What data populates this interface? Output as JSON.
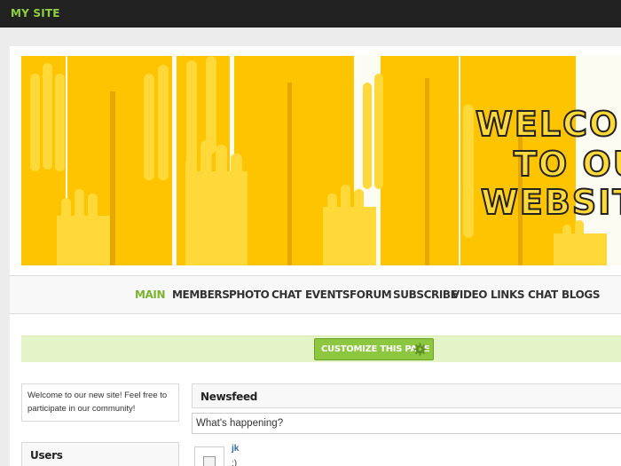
{
  "header": {
    "site_title": "MY SITE"
  },
  "banner": {
    "welcome_lines": [
      "WELCO",
      "TO OU",
      "WEBSIT"
    ],
    "colors": {
      "hand_main": "#ffc400",
      "hand_light": "#ffd93a",
      "hand_dark": "#e6a800",
      "background": "#fdfcf3"
    }
  },
  "nav": {
    "items": [
      {
        "label": "MAIN",
        "active": true
      },
      {
        "label": "MEMBERS"
      },
      {
        "label": "PHOTO"
      },
      {
        "label": "CHAT"
      },
      {
        "label": "EVENTS"
      },
      {
        "label": "FORUM"
      },
      {
        "label": "SUBSCRIBE"
      },
      {
        "label": "VIDEO"
      },
      {
        "label": "LINKS"
      },
      {
        "label": "CHAT"
      },
      {
        "label": "BLOGS"
      }
    ],
    "active_color": "#7ab32e"
  },
  "customize": {
    "label": "CUSTOMIZE THIS PAGE",
    "icon": "gear-icon",
    "button_color": "#8dc63f"
  },
  "sidebar": {
    "welcome_text": "Welcome to our new site! Feel free to participate in our community!",
    "users_title": "Users"
  },
  "newsfeed": {
    "title": "Newsfeed",
    "input_value": "What's happening?",
    "post": {
      "author": "jk",
      "text": ":)"
    }
  }
}
